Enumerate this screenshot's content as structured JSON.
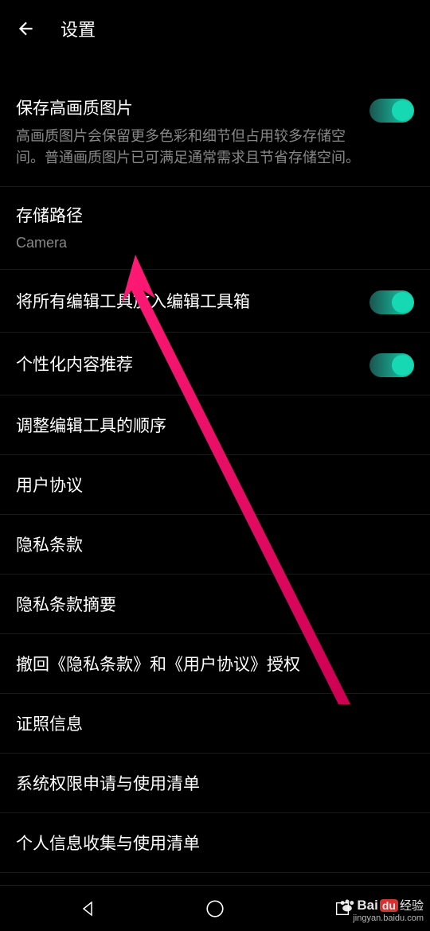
{
  "header": {
    "title": "设置"
  },
  "settings": [
    {
      "title": "保存高画质图片",
      "desc": "高画质图片会保留更多色彩和细节但占用较多存储空间。普通画质图片已可满足通常需求且节省存储空间。",
      "toggle": true
    },
    {
      "title": "存储路径",
      "subtitle": "Camera"
    },
    {
      "title": "将所有编辑工具放入编辑工具箱",
      "toggle": true
    },
    {
      "title": "个性化内容推荐",
      "toggle": true
    },
    {
      "title": "调整编辑工具的顺序"
    },
    {
      "title": "用户协议"
    },
    {
      "title": "隐私条款"
    },
    {
      "title": "隐私条款摘要"
    },
    {
      "title": "撤回《隐私条款》和《用户协议》授权"
    },
    {
      "title": "证照信息"
    },
    {
      "title": "系统权限申请与使用清单"
    },
    {
      "title": "个人信息收集与使用清单"
    }
  ],
  "watermark": {
    "brand1": "Bai",
    "brand2": "经验",
    "badge": "du",
    "url": "jingyan.baidu.com"
  },
  "colors": {
    "accent": "#16d9b4",
    "arrow": "#e91e63"
  }
}
